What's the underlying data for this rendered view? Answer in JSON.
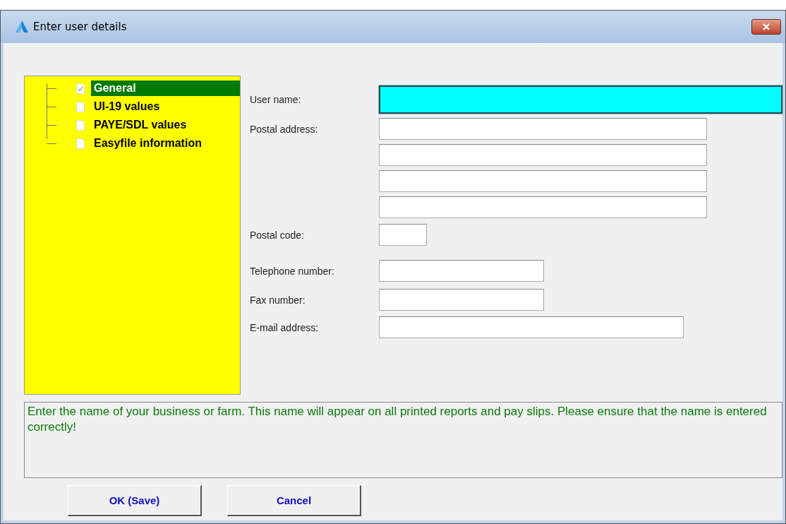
{
  "window": {
    "title": "Enter user details"
  },
  "tree": {
    "items": [
      {
        "label": "General",
        "selected": true,
        "checked": true
      },
      {
        "label": "UI-19 values",
        "selected": false,
        "checked": false
      },
      {
        "label": "PAYE/SDL values",
        "selected": false,
        "checked": false
      },
      {
        "label": "Easyfile information",
        "selected": false,
        "checked": false
      }
    ]
  },
  "fields": [
    {
      "kind": "name",
      "label": "User name:",
      "focused": true
    },
    {
      "kind": "address",
      "label": "Postal address:",
      "focused": false
    },
    {
      "kind": "address",
      "focused": false
    },
    {
      "kind": "address",
      "focused": false
    },
    {
      "kind": "address",
      "focused": false
    },
    {
      "kind": "code",
      "label": "Postal code:",
      "focused": false
    },
    {
      "kind": "phone",
      "label": "Telephone number:",
      "focused": false
    },
    {
      "kind": "phone",
      "label": "Fax number:",
      "focused": false
    },
    {
      "kind": "email",
      "label": "E-mail address:",
      "focused": false
    }
  ],
  "help": "Enter the name of your business or farm.  This name will appear on all printed reports and pay slips. Please ensure that the name is entered correctly!",
  "buttons": [
    "OK (Save)",
    "Cancel"
  ]
}
